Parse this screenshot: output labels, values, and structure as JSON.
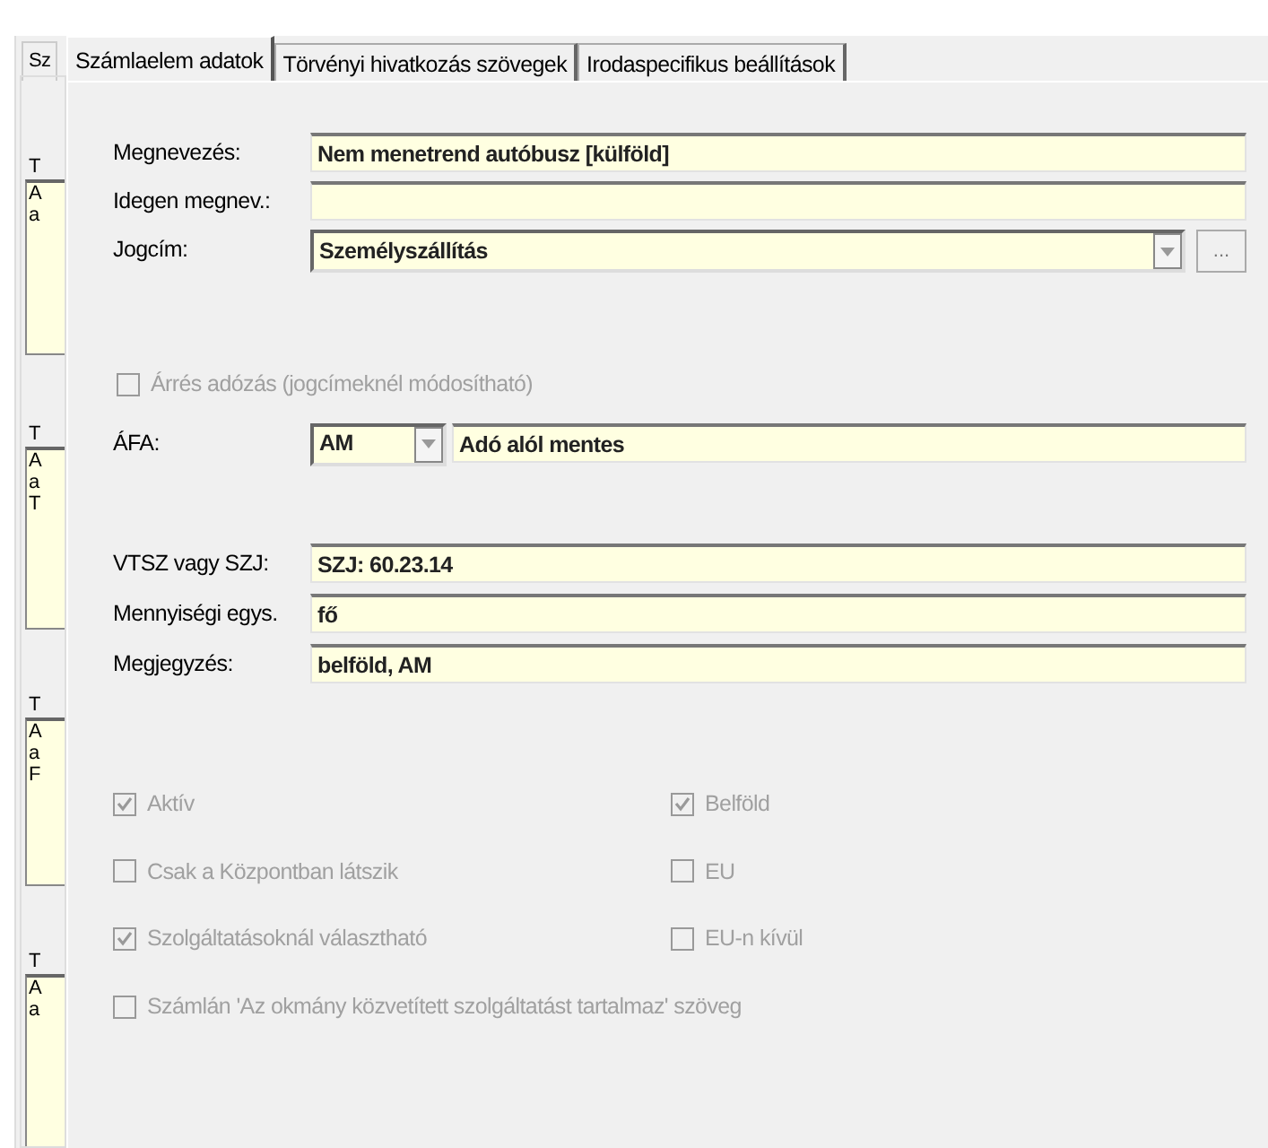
{
  "background_tab": {
    "label": "Sz"
  },
  "back_panel": {
    "groups": [
      {
        "label": "T",
        "lines": [
          "A",
          "a"
        ]
      },
      {
        "label": "T",
        "lines": [
          "A",
          "a",
          "T"
        ]
      },
      {
        "label": "T",
        "lines": [
          "A",
          "a",
          "F"
        ]
      },
      {
        "label": "T",
        "lines": [
          "A",
          "a"
        ]
      }
    ]
  },
  "tabs": [
    {
      "label": "Számlaelem adatok",
      "selected": true
    },
    {
      "label": "Törvényi hivatkozás szövegek",
      "selected": false
    },
    {
      "label": "Irodaspecifikus beállítások",
      "selected": false
    }
  ],
  "form": {
    "fields": [
      {
        "kind": "text",
        "label": "Megnevezés:",
        "value": "Nem menetrend autóbusz [külföld]"
      },
      {
        "kind": "text",
        "label": "Idegen megnev.:"
      },
      {
        "kind": "combo",
        "label": "Jogcím:",
        "value": "Személyszállítás",
        "button": "..."
      },
      {
        "kind": "checkbox",
        "label": "Árrés adózás (jogcímeknél módosítható)",
        "checked": false,
        "disabled": true
      },
      {
        "kind": "code_combo",
        "label": "ÁFA:",
        "code": "AM",
        "value": "Adó alól mentes"
      }
    ],
    "identifiers": [
      {
        "label": "VTSZ vagy SZJ:",
        "value": "SZJ: 60.23.14"
      },
      {
        "label": "Mennyiségi egys.",
        "value": "fő"
      },
      {
        "label": "Megjegyzés:",
        "value": "belföld, AM"
      }
    ],
    "options": [
      {
        "label": "Aktív",
        "checked": true,
        "disabled": true,
        "kind": "normal"
      },
      {
        "label": "Belföld",
        "checked": true,
        "disabled": true,
        "kind": "normal"
      },
      {
        "label": "Csak a Központban látszik",
        "checked": false,
        "disabled": true,
        "kind": "normal"
      },
      {
        "label": "EU",
        "checked": false,
        "disabled": true,
        "kind": "normal"
      },
      {
        "label": "Szolgáltatásoknál választható",
        "checked": true,
        "disabled": true,
        "kind": "normal"
      },
      {
        "label": "EU-n kívül",
        "checked": false,
        "disabled": true,
        "kind": "normal"
      },
      {
        "label": "Számlán 'Az okmány közvetített szolgáltatást tartalmaz' szöveg",
        "checked": false,
        "disabled": true,
        "kind": "wide"
      }
    ]
  }
}
